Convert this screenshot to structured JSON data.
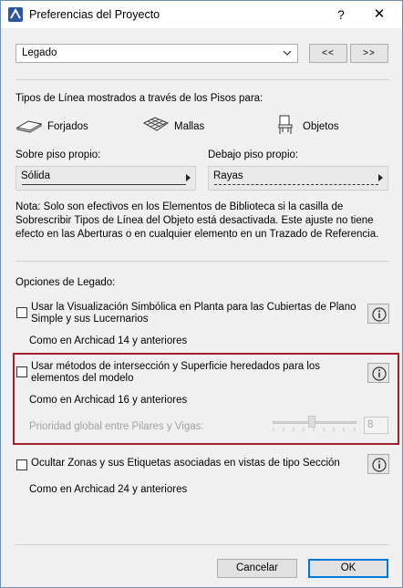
{
  "window": {
    "title": "Preferencias del Proyecto",
    "help": "?",
    "close": "✕"
  },
  "preset": {
    "value": "Legado",
    "prev": "<<",
    "next": ">>"
  },
  "line_types": {
    "heading": "Tipos de Línea mostrados a través de los Pisos para:",
    "items": [
      {
        "label": "Forjados",
        "icon": "slab-icon"
      },
      {
        "label": "Mallas",
        "icon": "mesh-icon"
      },
      {
        "label": "Objetos",
        "icon": "chair-icon"
      }
    ],
    "own_story_label": "Sobre piso propio:",
    "own_story_value": "Sólida",
    "below_story_label": "Debajo piso propio:",
    "below_story_value": "Rayas"
  },
  "note": "Nota: Solo son efectivos en los Elementos de Biblioteca si la casilla de Sobrescribir Tipos de Línea del Objeto está desactivada. Este ajuste no tiene efecto en las Aberturas o en cualquier elemento en un Trazado de Referencia.",
  "legacy": {
    "heading": "Opciones de Legado:",
    "option1": {
      "label_l1": "Usar la Visualización Simbólica en Planta para las Cubiertas de Plano",
      "label_l2": "Simple y sus Lucernarios",
      "sub": "Como en Archicad 14 y anteriores",
      "checked": false
    },
    "option2": {
      "label_l1": "Usar métodos de intersección y Superficie heredados para los",
      "label_l2": "elementos del modelo",
      "sub": "Como en Archicad 16 y anteriores",
      "checked": false,
      "priority_label": "Prioridad global entre Pilares y Vigas:",
      "priority_value": "8"
    },
    "option3": {
      "label": "Ocultar Zonas y sus Etiquetas asociadas en vistas de tipo Sección",
      "sub": "Como en Archicad 24 y anteriores",
      "checked": false
    }
  },
  "footer": {
    "cancel": "Cancelar",
    "ok": "OK"
  },
  "colors": {
    "highlight_border": "#a31f29",
    "ok_border": "#0078d7",
    "title_icon": "#2b579a"
  }
}
